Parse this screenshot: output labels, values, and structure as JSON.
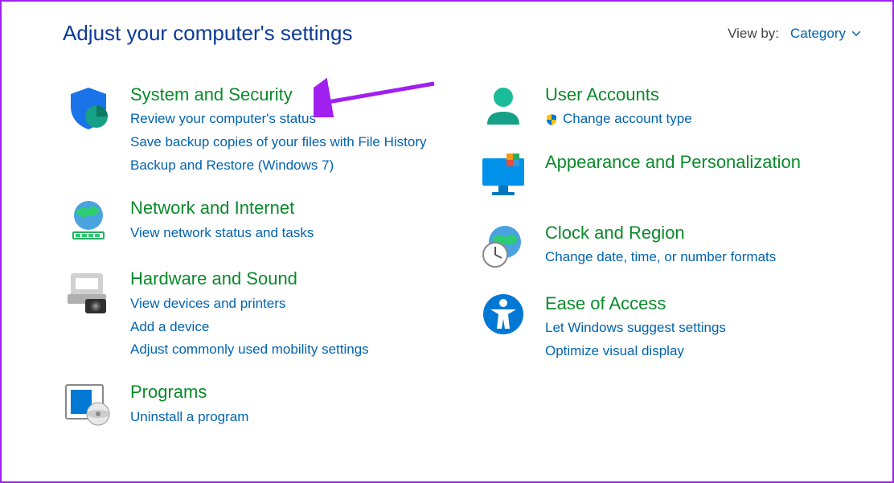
{
  "header": {
    "title": "Adjust your computer's settings",
    "viewby_label": "View by:",
    "viewby_value": "Category"
  },
  "left": [
    {
      "id": "system-security",
      "title": "System and Security",
      "links": [
        "Review your computer's status",
        "Save backup copies of your files with File History",
        "Backup and Restore (Windows 7)"
      ]
    },
    {
      "id": "network-internet",
      "title": "Network and Internet",
      "links": [
        "View network status and tasks"
      ]
    },
    {
      "id": "hardware-sound",
      "title": "Hardware and Sound",
      "links": [
        "View devices and printers",
        "Add a device",
        "Adjust commonly used mobility settings"
      ]
    },
    {
      "id": "programs",
      "title": "Programs",
      "links": [
        "Uninstall a program"
      ]
    }
  ],
  "right": [
    {
      "id": "user-accounts",
      "title": "User Accounts",
      "links": [
        "Change account type"
      ],
      "shielded": true
    },
    {
      "id": "appearance",
      "title": "Appearance and Personalization",
      "links": []
    },
    {
      "id": "clock-region",
      "title": "Clock and Region",
      "links": [
        "Change date, time, or number formats"
      ]
    },
    {
      "id": "ease-of-access",
      "title": "Ease of Access",
      "links": [
        "Let Windows suggest settings",
        "Optimize visual display"
      ]
    }
  ]
}
